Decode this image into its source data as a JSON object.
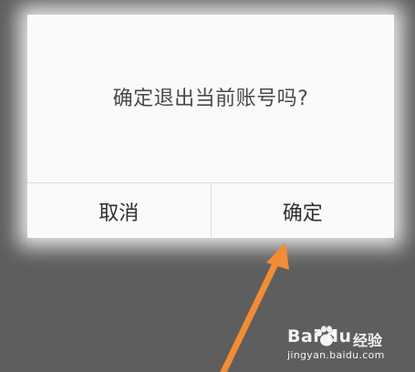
{
  "dialog": {
    "message": "确定退出当前账号吗?",
    "cancel_label": "取消",
    "confirm_label": "确定"
  },
  "annotation": {
    "arrow_color": "#f28c35"
  },
  "watermark": {
    "brand": "Bai du",
    "brand_cn": "经验",
    "url": "jingyan.baidu.com"
  }
}
